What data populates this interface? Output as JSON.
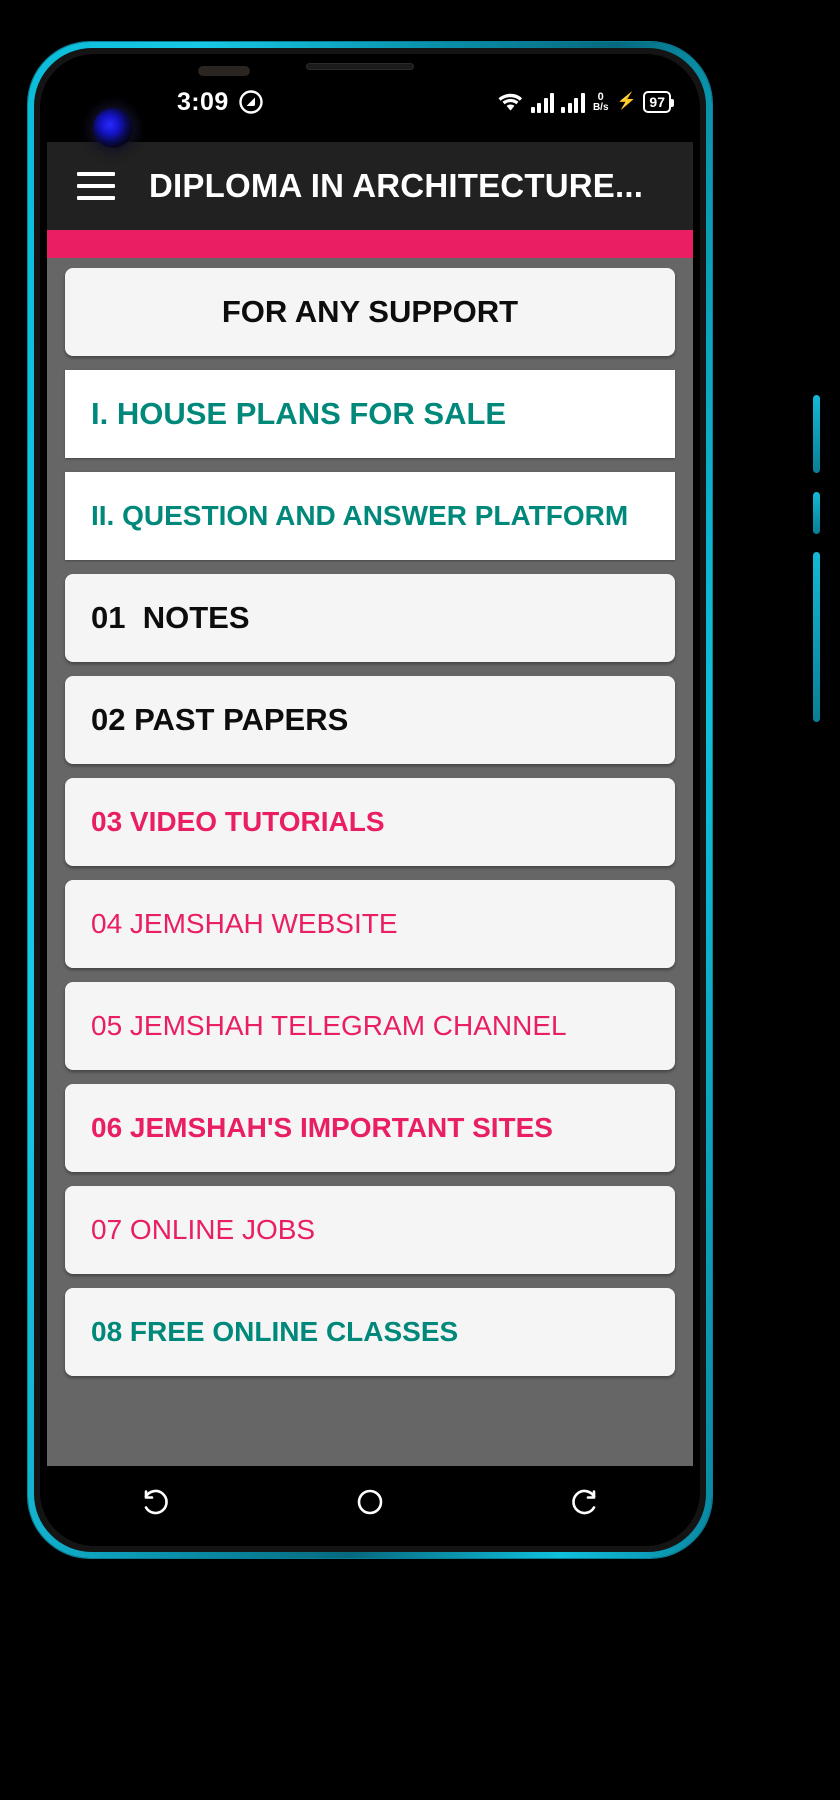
{
  "status_bar": {
    "time": "3:09",
    "left_icon": "quick-capture-icon",
    "wifi_icon": "wifi-icon",
    "signal_icon_1": "signal-bars-sim1-icon",
    "signal_icon_2": "signal-bars-sim2-icon",
    "network_speed_value": "0",
    "network_speed_unit": "B/s",
    "charging_icon": "charging-bolt-icon",
    "battery_percent": "97"
  },
  "app_bar": {
    "menu_icon": "hamburger-menu-icon",
    "title": "DIPLOMA IN ARCHITECTURE..."
  },
  "accent": {
    "color": "#e91e63"
  },
  "list": {
    "items": [
      {
        "label": "FOR ANY SUPPORT",
        "color_class": "c-black",
        "weight_class": "w-bold",
        "size_class": "fs-big",
        "align": "center",
        "style": "rounded",
        "name": "list-item-for-any-support"
      },
      {
        "label": "I. HOUSE PLANS FOR SALE",
        "color_class": "c-teal",
        "weight_class": "w-bold",
        "size_class": "fs-big",
        "align": "left",
        "style": "sharp",
        "name": "list-item-house-plans-for-sale"
      },
      {
        "label": "II. QUESTION AND ANSWER PLATFORM",
        "color_class": "c-teal",
        "weight_class": "w-bold",
        "size_class": "fs-mid",
        "align": "left",
        "style": "sharp",
        "name": "list-item-question-and-answer-platform"
      },
      {
        "label": "01  NOTES",
        "color_class": "c-black",
        "weight_class": "w-bold",
        "size_class": "fs-big",
        "align": "left",
        "style": "rounded",
        "name": "list-item-01-notes"
      },
      {
        "label": "02 PAST PAPERS",
        "color_class": "c-black",
        "weight_class": "w-bold",
        "size_class": "fs-big",
        "align": "left",
        "style": "rounded",
        "name": "list-item-02-past-papers"
      },
      {
        "label": "03 VIDEO TUTORIALS",
        "color_class": "c-pink",
        "weight_class": "w-bold",
        "size_class": "fs-mid",
        "align": "left",
        "style": "rounded",
        "name": "list-item-03-video-tutorials"
      },
      {
        "label": "04 JEMSHAH WEBSITE",
        "color_class": "c-pink",
        "weight_class": "w-reg",
        "size_class": "fs-mid",
        "align": "left",
        "style": "rounded",
        "name": "list-item-04-jemshah-website"
      },
      {
        "label": "05 JEMSHAH TELEGRAM CHANNEL",
        "color_class": "c-pink",
        "weight_class": "w-reg",
        "size_class": "fs-mid",
        "align": "left",
        "style": "rounded",
        "name": "list-item-05-jemshah-telegram-channel"
      },
      {
        "label": "06 JEMSHAH'S IMPORTANT SITES",
        "color_class": "c-pink",
        "weight_class": "w-bold",
        "size_class": "fs-mid",
        "align": "left",
        "style": "rounded",
        "name": "list-item-06-jemshahs-important-sites"
      },
      {
        "label": "07 ONLINE JOBS",
        "color_class": "c-pink",
        "weight_class": "w-reg",
        "size_class": "fs-mid",
        "align": "left",
        "style": "rounded",
        "name": "list-item-07-online-jobs"
      },
      {
        "label": "08 FREE ONLINE CLASSES",
        "color_class": "c-teal",
        "weight_class": "w-bold",
        "size_class": "fs-mid",
        "align": "left",
        "style": "rounded",
        "name": "list-item-08-free-online-classes"
      }
    ]
  },
  "nav_bar": {
    "recents_icon": "recents-icon",
    "home_icon": "home-icon",
    "back_icon": "back-icon"
  }
}
